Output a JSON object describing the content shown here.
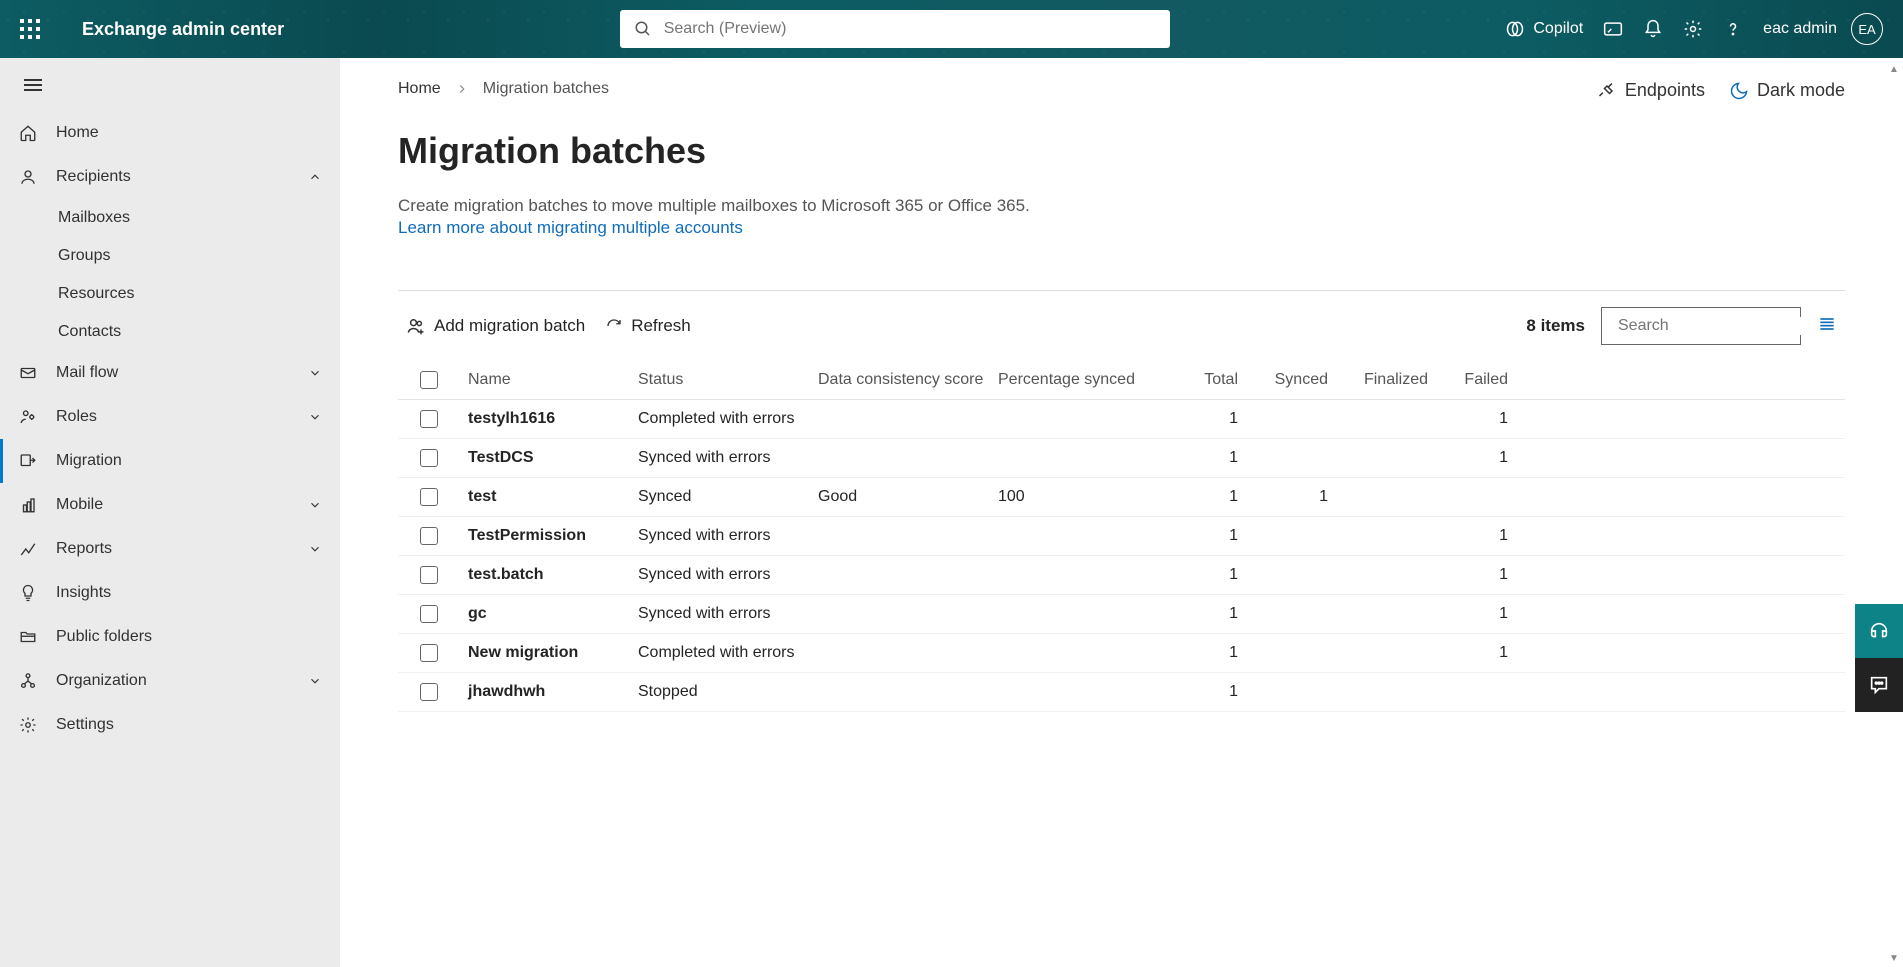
{
  "header": {
    "appTitle": "Exchange admin center",
    "searchPlaceholder": "Search (Preview)",
    "copilot": "Copilot",
    "userName": "eac admin",
    "userInitials": "EA"
  },
  "sidebar": {
    "items": [
      {
        "label": "Home"
      },
      {
        "label": "Recipients",
        "expanded": true,
        "children": [
          "Mailboxes",
          "Groups",
          "Resources",
          "Contacts"
        ]
      },
      {
        "label": "Mail flow",
        "expandable": true
      },
      {
        "label": "Roles",
        "expandable": true
      },
      {
        "label": "Migration",
        "selected": true
      },
      {
        "label": "Mobile",
        "expandable": true
      },
      {
        "label": "Reports",
        "expandable": true
      },
      {
        "label": "Insights"
      },
      {
        "label": "Public folders"
      },
      {
        "label": "Organization",
        "expandable": true
      },
      {
        "label": "Settings"
      }
    ]
  },
  "breadcrumb": {
    "home": "Home",
    "current": "Migration batches"
  },
  "topActions": {
    "endpoints": "Endpoints",
    "darkmode": "Dark mode"
  },
  "page": {
    "title": "Migration batches",
    "desc": "Create migration batches to move multiple mailboxes to Microsoft 365 or Office 365.",
    "learn": "Learn more about migrating multiple accounts"
  },
  "toolbar": {
    "add": "Add migration batch",
    "refresh": "Refresh",
    "itemsCount": "8 items",
    "searchPlaceholder": "Search"
  },
  "table": {
    "headers": {
      "name": "Name",
      "status": "Status",
      "dcs": "Data consistency score",
      "pct": "Percentage synced",
      "total": "Total",
      "synced": "Synced",
      "finalized": "Finalized",
      "failed": "Failed"
    },
    "rows": [
      {
        "name": "testylh1616",
        "status": "Completed with errors",
        "dcs": "",
        "pct": "",
        "total": "1",
        "synced": "",
        "finalized": "",
        "failed": "1"
      },
      {
        "name": "TestDCS",
        "status": "Synced with errors",
        "dcs": "",
        "pct": "",
        "total": "1",
        "synced": "",
        "finalized": "",
        "failed": "1"
      },
      {
        "name": "test",
        "status": "Synced",
        "dcs": "Good",
        "pct": "100",
        "total": "1",
        "synced": "1",
        "finalized": "",
        "failed": ""
      },
      {
        "name": "TestPermission",
        "status": "Synced with errors",
        "dcs": "",
        "pct": "",
        "total": "1",
        "synced": "",
        "finalized": "",
        "failed": "1"
      },
      {
        "name": "test.batch",
        "status": "Synced with errors",
        "dcs": "",
        "pct": "",
        "total": "1",
        "synced": "",
        "finalized": "",
        "failed": "1"
      },
      {
        "name": "gc",
        "status": "Synced with errors",
        "dcs": "",
        "pct": "",
        "total": "1",
        "synced": "",
        "finalized": "",
        "failed": "1"
      },
      {
        "name": "New migration",
        "status": "Completed with errors",
        "dcs": "",
        "pct": "",
        "total": "1",
        "synced": "",
        "finalized": "",
        "failed": "1"
      },
      {
        "name": "jhawdhwh",
        "status": "Stopped",
        "dcs": "",
        "pct": "",
        "total": "1",
        "synced": "",
        "finalized": "",
        "failed": ""
      }
    ]
  }
}
